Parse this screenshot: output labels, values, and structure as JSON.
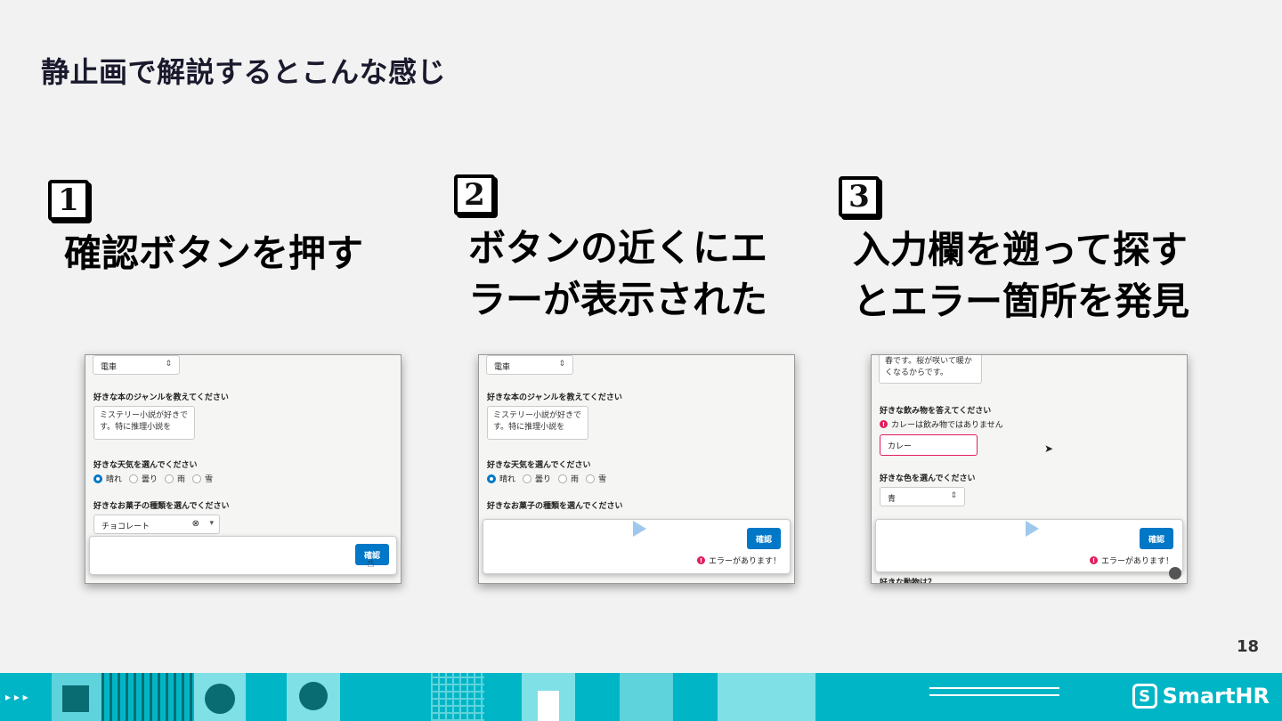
{
  "slide": {
    "title": "静止画で解説するとこんな感じ",
    "page_number": "18"
  },
  "steps": [
    {
      "num": "1",
      "text": "確認ボタンを押す"
    },
    {
      "num": "2",
      "text": "ボタンの近くにエ\nラーが表示された"
    },
    {
      "num": "3",
      "text": "入力欄を遡って探す\nとエラー箇所を発見"
    }
  ],
  "shot1": {
    "transport_value": "電車",
    "genre_label": "好きな本のジャンルを教えてください",
    "genre_text": "ミステリー小説が好きです。特に推理小説を",
    "weather_label": "好きな天気を選んでください",
    "weather_options": [
      "晴れ",
      "曇り",
      "雨",
      "雪"
    ],
    "snack_label": "好きなお菓子の種類を選んでください",
    "snack_value": "チョコレート",
    "confirm_label": "確認"
  },
  "shot2": {
    "transport_value": "電車",
    "genre_label": "好きな本のジャンルを教えてください",
    "genre_text": "ミステリー小説が好きです。特に推理小説を",
    "weather_label": "好きな天気を選んでください",
    "weather_options": [
      "晴れ",
      "曇り",
      "雨",
      "雪"
    ],
    "snack_label": "好きなお菓子の種類を選んでください",
    "confirm_label": "確認",
    "error_text": "エラーがあります！"
  },
  "shot3": {
    "season_text": "春です。桜が咲いて暖かくなるからです。",
    "drink_label": "好きな飲み物を答えてください",
    "drink_error": "カレーは飲み物ではありません",
    "drink_value": "カレー",
    "color_label": "好きな色を選んでください",
    "color_value": "青",
    "confirm_label": "確認",
    "error_text": "エラーがあります！",
    "animal_label": "好きな動物は？"
  },
  "brand": {
    "logo_text": "SmartHR",
    "footer_color": "#00b6c6",
    "accent": "#0077c7",
    "error_color": "#e01e5a"
  },
  "icons": {
    "sort": "⇕",
    "clear": "⊗",
    "chevron": "▾",
    "play": "play-icon",
    "error": "!"
  }
}
